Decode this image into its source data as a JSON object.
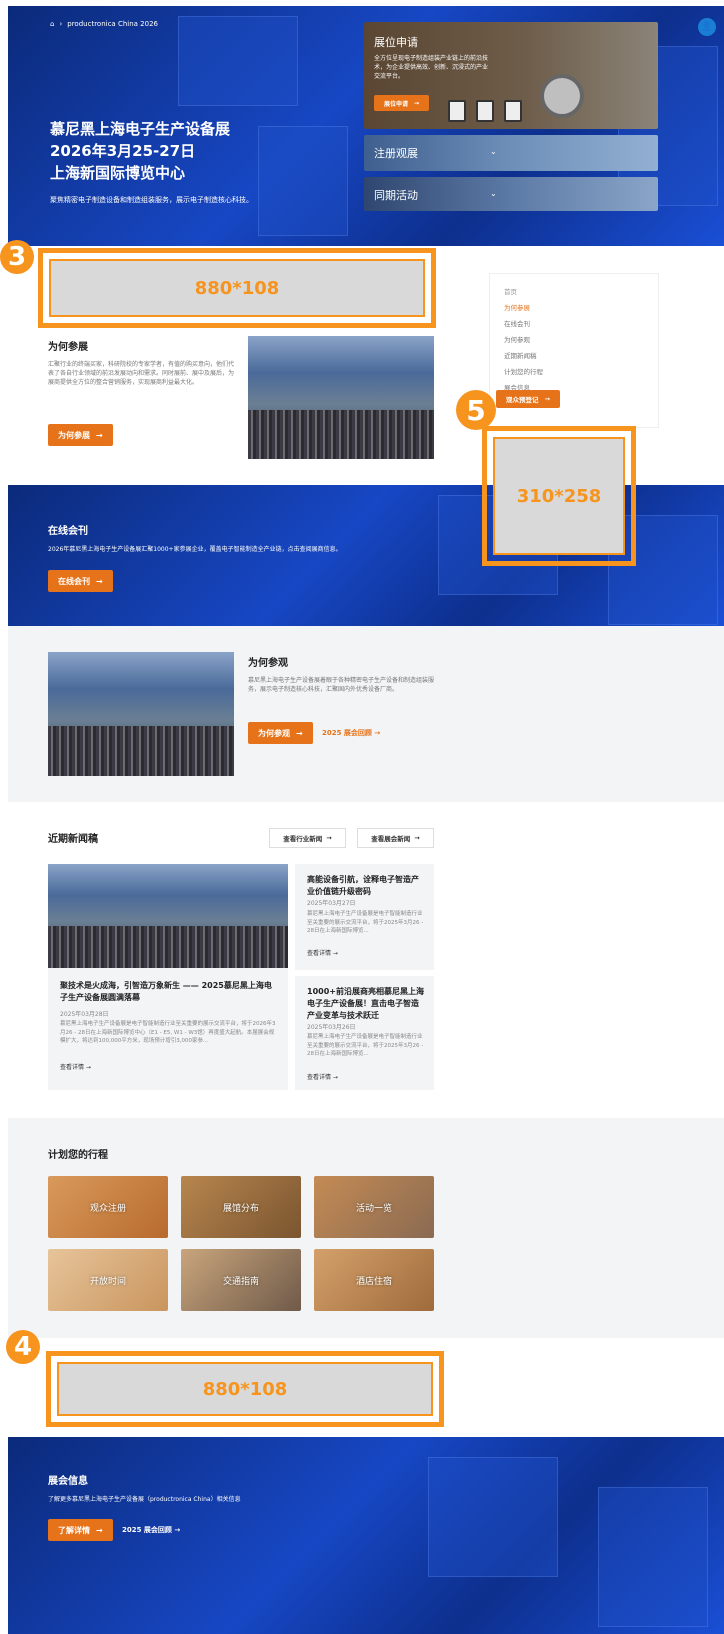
{
  "hero": {
    "breadcrumb": "productronica China 2026",
    "title_line1": "慕尼黑上海电子生产设备展",
    "title_line2": "2026年3月25-27日",
    "title_line3": "上海新国际博览中心",
    "subtitle": "聚焦精密电子制造设备和制造组装服务，展示电子制造核心科技。"
  },
  "cards": [
    {
      "title": "展位申请",
      "desc": "全方位呈现电子制造组装产业链上的前沿技术，为企业提供高效、创新、沉浸式的产业交流平台。",
      "button": "展位申请"
    },
    {
      "title": "注册观展"
    },
    {
      "title": "同期活动"
    }
  ],
  "ads": {
    "banner_top": "880*108",
    "banner_bottom": "880*108",
    "side": "310*258",
    "badge3": "3",
    "badge4": "4",
    "badge5": "5"
  },
  "why_exhibit": {
    "title": "为何参展",
    "desc": "汇聚行业的终端买家，科研院校的专家学者，有值的购买意向，他们代表了各自行业领域的前沿发展动向和需求。同时展前、展中及展后，为展商提供全方位的整合营销服务，实现展商利益最大化。",
    "button": "为何参展"
  },
  "sidenav": {
    "home": "首页",
    "items": [
      "为何参展",
      "在线会刊",
      "为何参观",
      "近期新闻稿",
      "计划您的行程",
      "展会信息"
    ],
    "button": "观众预登记"
  },
  "catalog": {
    "title": "在线会刊",
    "desc": "2026年慕尼黑上海电子生产设备展汇聚1000+家参展企业，覆盖电子智能制造全产业链，点击查阅展商信息。",
    "button": "在线会刊"
  },
  "why_visit": {
    "title": "为何参观",
    "desc": "慕尼黑上海电子生产设备展着眼于各种精密电子生产设备和制造组装服务，展示电子制造核心科技，汇聚国内外优秀设备厂商。",
    "button": "为何参观",
    "link": "2025 展会回顾"
  },
  "news": {
    "title": "近期新闻稿",
    "btn_industry": "查看行业新闻",
    "btn_show": "查看展会新闻",
    "main": {
      "headline": "聚技术是火成海，引智造万象新生 —— 2025慕尼黑上海电子生产设备展圆满落幕",
      "date": "2025年03月28日",
      "excerpt": "慕尼黑上海电子生产设备展是电子智能制造行业至关重要的展示交流平台，将于2026年3月26 - 28日在上海新国际博览中心（E1 - E5, W1 - W3馆）再度盛大起航。本届展会规模扩大，将达到100,000平方米，现场预计增引3,000家参...",
      "more": "查看详情"
    },
    "side": [
      {
        "headline": "高能设备引航，诠释电子智造产业价值链升级密码",
        "date": "2025年03月27日",
        "excerpt": "慕尼黑上海电子生产设备展是电子智能制造行业至关重要的展示交流平台，将于2025年3月26 - 28日在上海新国际博览...",
        "more": "查看详情"
      },
      {
        "headline": "1000+前沿展商亮相慕尼黑上海电子生产设备展！直击电子智造产业变革与技术跃迁",
        "date": "2025年03月26日",
        "excerpt": "慕尼黑上海电子生产设备展是电子智能制造行业至关重要的展示交流平台，将于2025年3月26 - 28日在上海新国际博览...",
        "more": "查看详情"
      }
    ]
  },
  "plan": {
    "title": "计划您的行程",
    "tiles": [
      "观众注册",
      "展馆分布",
      "活动一览",
      "开放时间",
      "交通指南",
      "酒店住宿"
    ]
  },
  "expo_info": {
    "title": "展会信息",
    "desc": "了解更多慕尼黑上海电子生产设备展（productronica China）相关信息",
    "button": "了解详情",
    "link": "2025 展会回顾"
  }
}
